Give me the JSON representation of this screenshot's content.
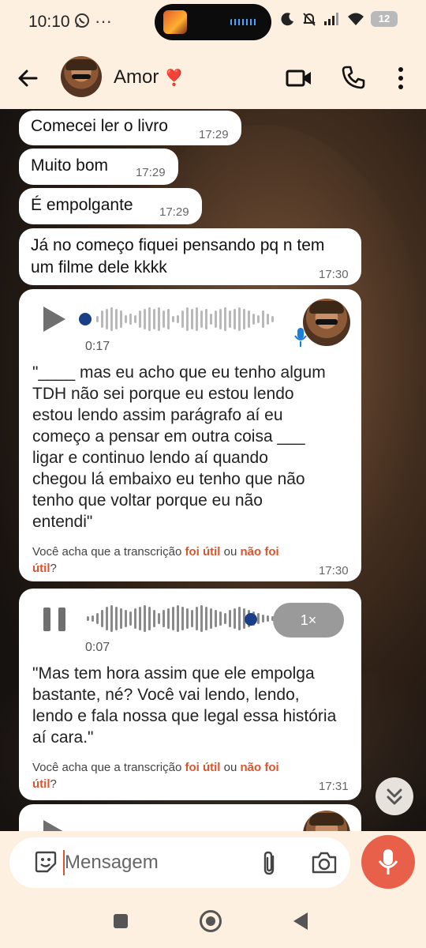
{
  "status_bar": {
    "time": "10:10",
    "left_icons": [
      "whatsapp-icon",
      "more-dots-icon"
    ],
    "right_icons": [
      "moon-icon",
      "muted-bell-icon",
      "signal-icon",
      "wifi-icon"
    ],
    "battery": "12"
  },
  "header": {
    "contact_name": "Amor",
    "heart": "❣️",
    "actions": [
      "video-call-icon",
      "phone-call-icon",
      "more-vert-icon"
    ]
  },
  "messages": [
    {
      "type": "text",
      "text": "Comecei ler o livro",
      "time": "17:29"
    },
    {
      "type": "text",
      "text": "Muito bom",
      "time": "17:29"
    },
    {
      "type": "text",
      "text": "É empolgante",
      "time": "17:29"
    },
    {
      "type": "text",
      "text": "Já no começo fiquei pensando pq n tem um filme dele kkkk",
      "time": "17:30"
    },
    {
      "type": "voice",
      "duration": "0:17",
      "progress": 0,
      "state": "paused",
      "transcript": "\"____ mas eu acho que eu tenho algum TDH não sei porque eu estou lendo estou lendo assim parágrafo aí eu começo a pensar em outra coisa ___ ligar e continuo lendo aí quando chegou lá embaixo eu tenho que não tenho que voltar porque eu não entendi\"",
      "feedback_prefix": "Você acha que a transcrição ",
      "feedback_yes": "foi útil",
      "feedback_or": " ou ",
      "feedback_no": "não foi útil",
      "feedback_suffix": "?",
      "time": "17:30"
    },
    {
      "type": "voice",
      "duration": "0:07",
      "progress": 1,
      "state": "playing",
      "speed": "1×",
      "transcript": "\"Mas tem hora assim que ele empolga bastante, né? Você vai lendo, lendo, lendo e fala nossa que legal essa história aí cara.\"",
      "feedback_prefix": "Você acha que a transcrição ",
      "feedback_yes": "foi útil",
      "feedback_or": " ou ",
      "feedback_no": "não foi útil",
      "feedback_suffix": "?",
      "time": "17:31"
    }
  ],
  "composer": {
    "placeholder": "Mensagem",
    "icons": [
      "emoji-sticker-icon",
      "paperclip-icon",
      "camera-icon",
      "microphone-icon"
    ]
  },
  "colors": {
    "accent": "#e8604a",
    "link": "#d9552f",
    "voice_dot": "#1b3f86",
    "background": "#fdf0e0"
  }
}
